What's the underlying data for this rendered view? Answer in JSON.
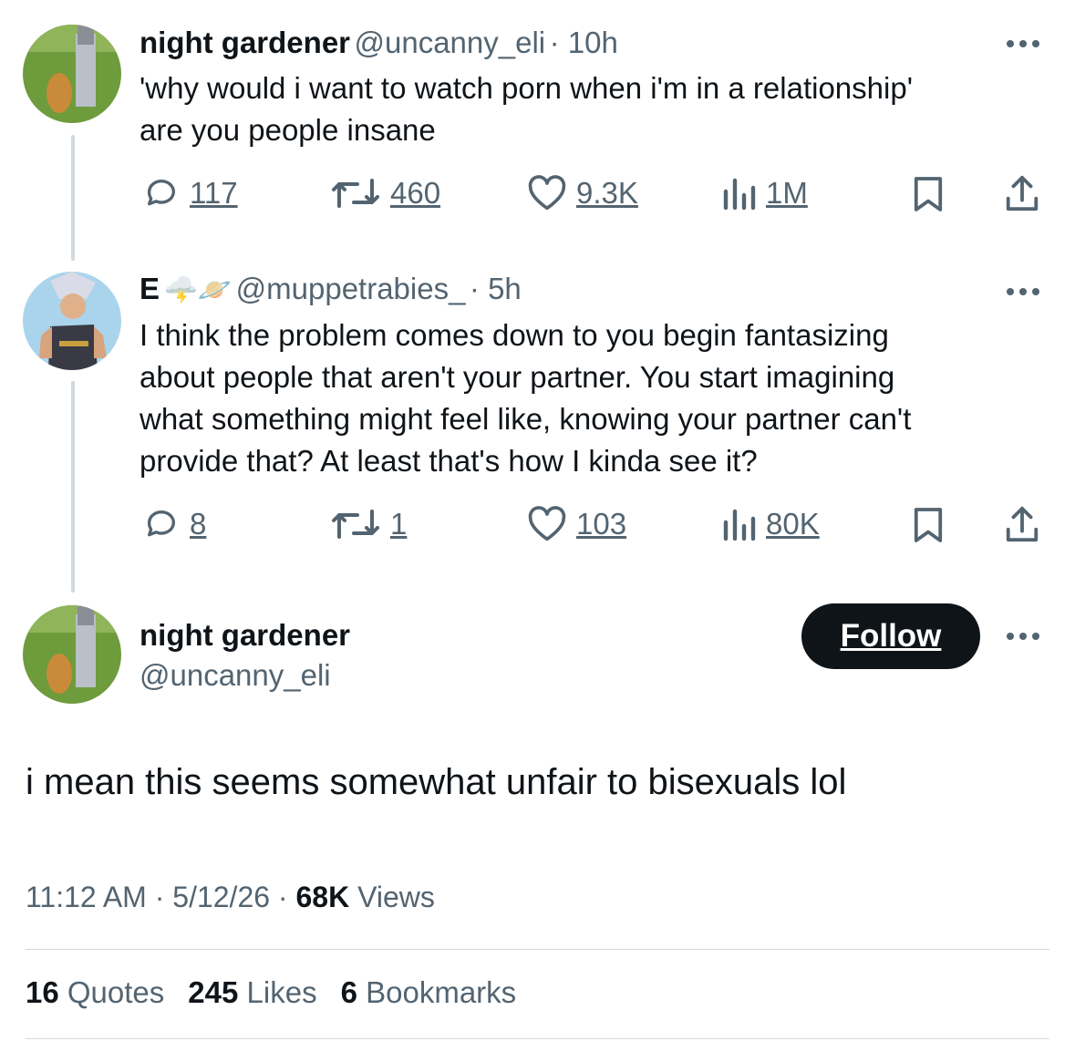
{
  "tweet1": {
    "name": "night gardener",
    "handle": "@uncanny_eli",
    "time": "· 10h",
    "text_line1": "'why would i want to watch porn when i'm in a relationship'",
    "text_line2": "are you people insane",
    "replies": "117",
    "retweets": "460",
    "likes": "9.3K",
    "views": "1M"
  },
  "tweet2": {
    "name": "E",
    "emoji": "🌩️🪐",
    "handle": "@muppetrabies_",
    "time": "· 5h",
    "text_line1": "I think the problem comes down to you begin fantasizing",
    "text_line2": "about people that aren't your partner. You start imagining",
    "text_line3": "what something might feel like, knowing your partner can't",
    "text_line4": "provide that? At least that's how I kinda see it?",
    "replies": "8",
    "retweets": "1",
    "likes": "103",
    "views": "80K"
  },
  "main_tweet": {
    "name": "night gardener",
    "handle": "@uncanny_eli",
    "follow_label": "Follow",
    "text": "i mean this seems somewhat unfair to bisexuals lol",
    "time": "11:12 AM · 5/12/26 ·",
    "views_count": "68K",
    "views_label": "Views",
    "quotes_count": "16",
    "quotes_label": "Quotes",
    "likes_count": "245",
    "likes_label": "Likes",
    "bookmarks_count": "6",
    "bookmarks_label": "Bookmarks"
  },
  "icons": [
    "reply-icon",
    "retweet-icon",
    "like-icon",
    "views-icon",
    "bookmark-icon",
    "share-icon",
    "more-icon"
  ],
  "colors": {
    "text": "#0f1419",
    "secondary": "#536471",
    "line": "#cfd9de",
    "button": "#0f1419"
  }
}
